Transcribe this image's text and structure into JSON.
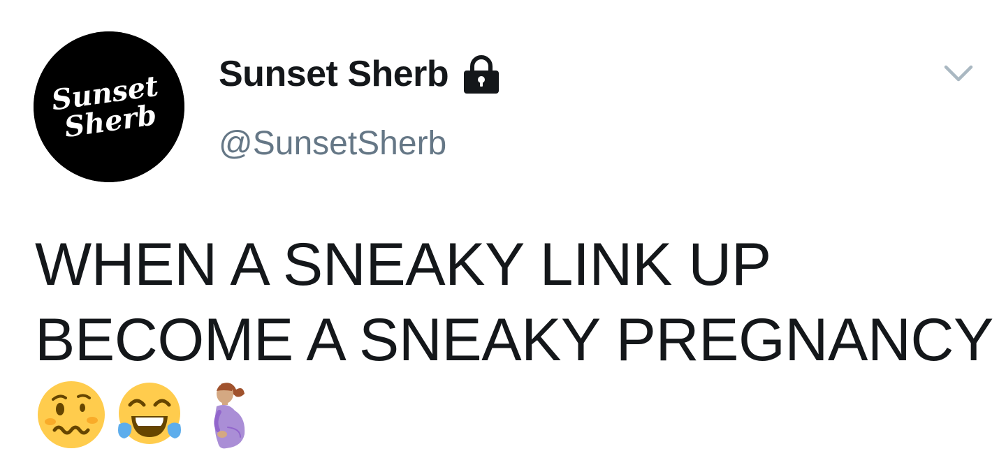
{
  "tweet": {
    "author": {
      "display_name": "Sunset Sherb",
      "handle": "@SunsetSherb",
      "avatar_text_line1": "Sunset",
      "avatar_text_line2": "Sherb",
      "protected_icon": "lock-icon"
    },
    "menu_icon": "chevron-down-icon",
    "text_lines": [
      "WHEN A SNEAKY LINK UP",
      "BECOME A SNEAKY PREGNANCY"
    ],
    "emojis": [
      {
        "name": "woozy-face-emoji",
        "char": "🥴"
      },
      {
        "name": "face-with-tears-of-joy-emoji",
        "char": "😂"
      },
      {
        "name": "pregnant-woman-emoji",
        "char": "🤰"
      }
    ]
  },
  "colors": {
    "text_primary": "#14171a",
    "text_secondary": "#657786",
    "caret": "#aab8c2",
    "emoji_yellow": "#ffcc4d",
    "tear_blue": "#5dadec",
    "dress_purple": "#aa8ed6"
  }
}
